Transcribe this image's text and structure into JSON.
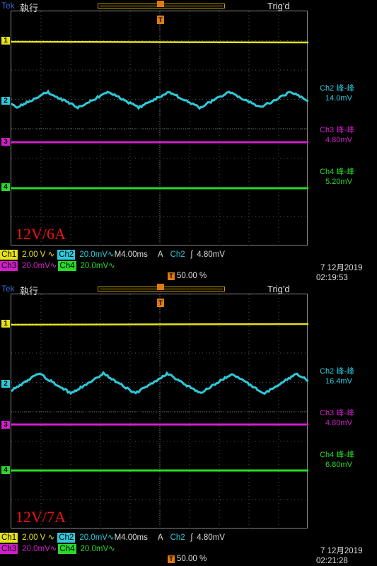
{
  "panels": [
    {
      "header": {
        "brand": "Tek",
        "mode": "執行",
        "trigger_status": "Trig'd"
      },
      "load": "12V/6A",
      "measurements": [
        {
          "label": "Ch2 峰-峰",
          "value": "14.0mV",
          "color": "#2ec9d9"
        },
        {
          "label": "Ch3 峰-峰",
          "value": "4.80mV",
          "color": "#d01fc8"
        },
        {
          "label": "Ch4 峰-峰",
          "value": "5.20mV",
          "color": "#2ad82a"
        }
      ],
      "status": {
        "ch1": "Ch1",
        "ch1_scale": "2.00 V",
        "ch2": "Ch2",
        "ch2_scale": "20.0mV",
        "timebase": "M4.00ms",
        "trig_mode": "A",
        "trig_src": "Ch2",
        "trig_level": "4.80mV",
        "ch3": "Ch3",
        "ch3_scale": "20.0mV",
        "ch4": "Ch4",
        "ch4_scale": "20.0mV",
        "trig_pos": "50.00 %",
        "date": "7 12月2019",
        "time": "02:19:53"
      }
    },
    {
      "header": {
        "brand": "Tek",
        "mode": "執行",
        "trigger_status": "Trig'd"
      },
      "load": "12V/7A",
      "measurements": [
        {
          "label": "Ch2 峰-峰",
          "value": "16.4mV",
          "color": "#2ec9d9"
        },
        {
          "label": "Ch3 峰-峰",
          "value": "4.80mV",
          "color": "#d01fc8"
        },
        {
          "label": "Ch4 峰-峰",
          "value": "6.80mV",
          "color": "#2ad82a"
        }
      ],
      "status": {
        "ch1": "Ch1",
        "ch1_scale": "2.00 V",
        "ch2": "Ch2",
        "ch2_scale": "20.0mV",
        "timebase": "M4.00ms",
        "trig_mode": "A",
        "trig_src": "Ch2",
        "trig_level": "4.80mV",
        "ch3": "Ch3",
        "ch3_scale": "20.0mV",
        "ch4": "Ch4",
        "ch4_scale": "20.0mV",
        "trig_pos": "50.00 %",
        "date": "7 12月2019",
        "time": "02:21:28"
      }
    }
  ],
  "channel_markers": [
    "1",
    "2",
    "3",
    "4"
  ],
  "colors": {
    "ch1": "#e6e21a",
    "ch2": "#2ec9d9",
    "ch3": "#d01fc8",
    "ch4": "#2ad82a",
    "trigger": "#e07a10",
    "label_red": "#e11111"
  }
}
